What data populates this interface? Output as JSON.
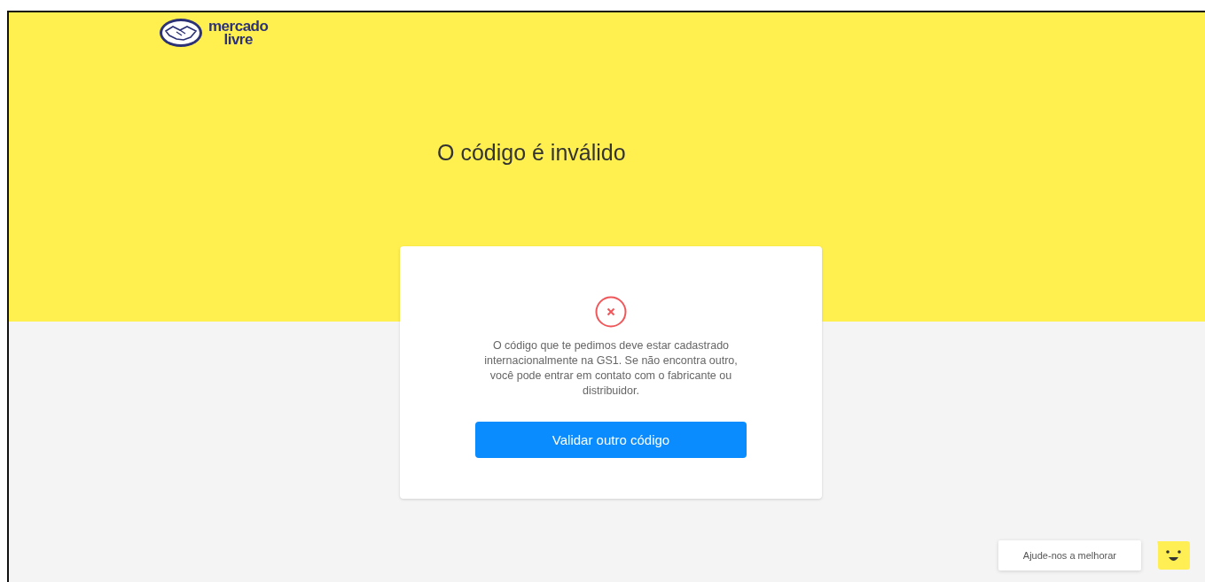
{
  "header": {
    "logo_text": [
      "mercado",
      "livre"
    ],
    "title": "O código é inválido"
  },
  "card": {
    "kind": "error",
    "message": "O código que te pedimos deve estar cadastrado internacionalmente na GS1. Se não encontra outro, você pode entrar em contato com o fabricante ou distribuidor.",
    "button": "Validar outro código"
  },
  "feedback": {
    "label": "Ajude-nos a melhorar"
  }
}
